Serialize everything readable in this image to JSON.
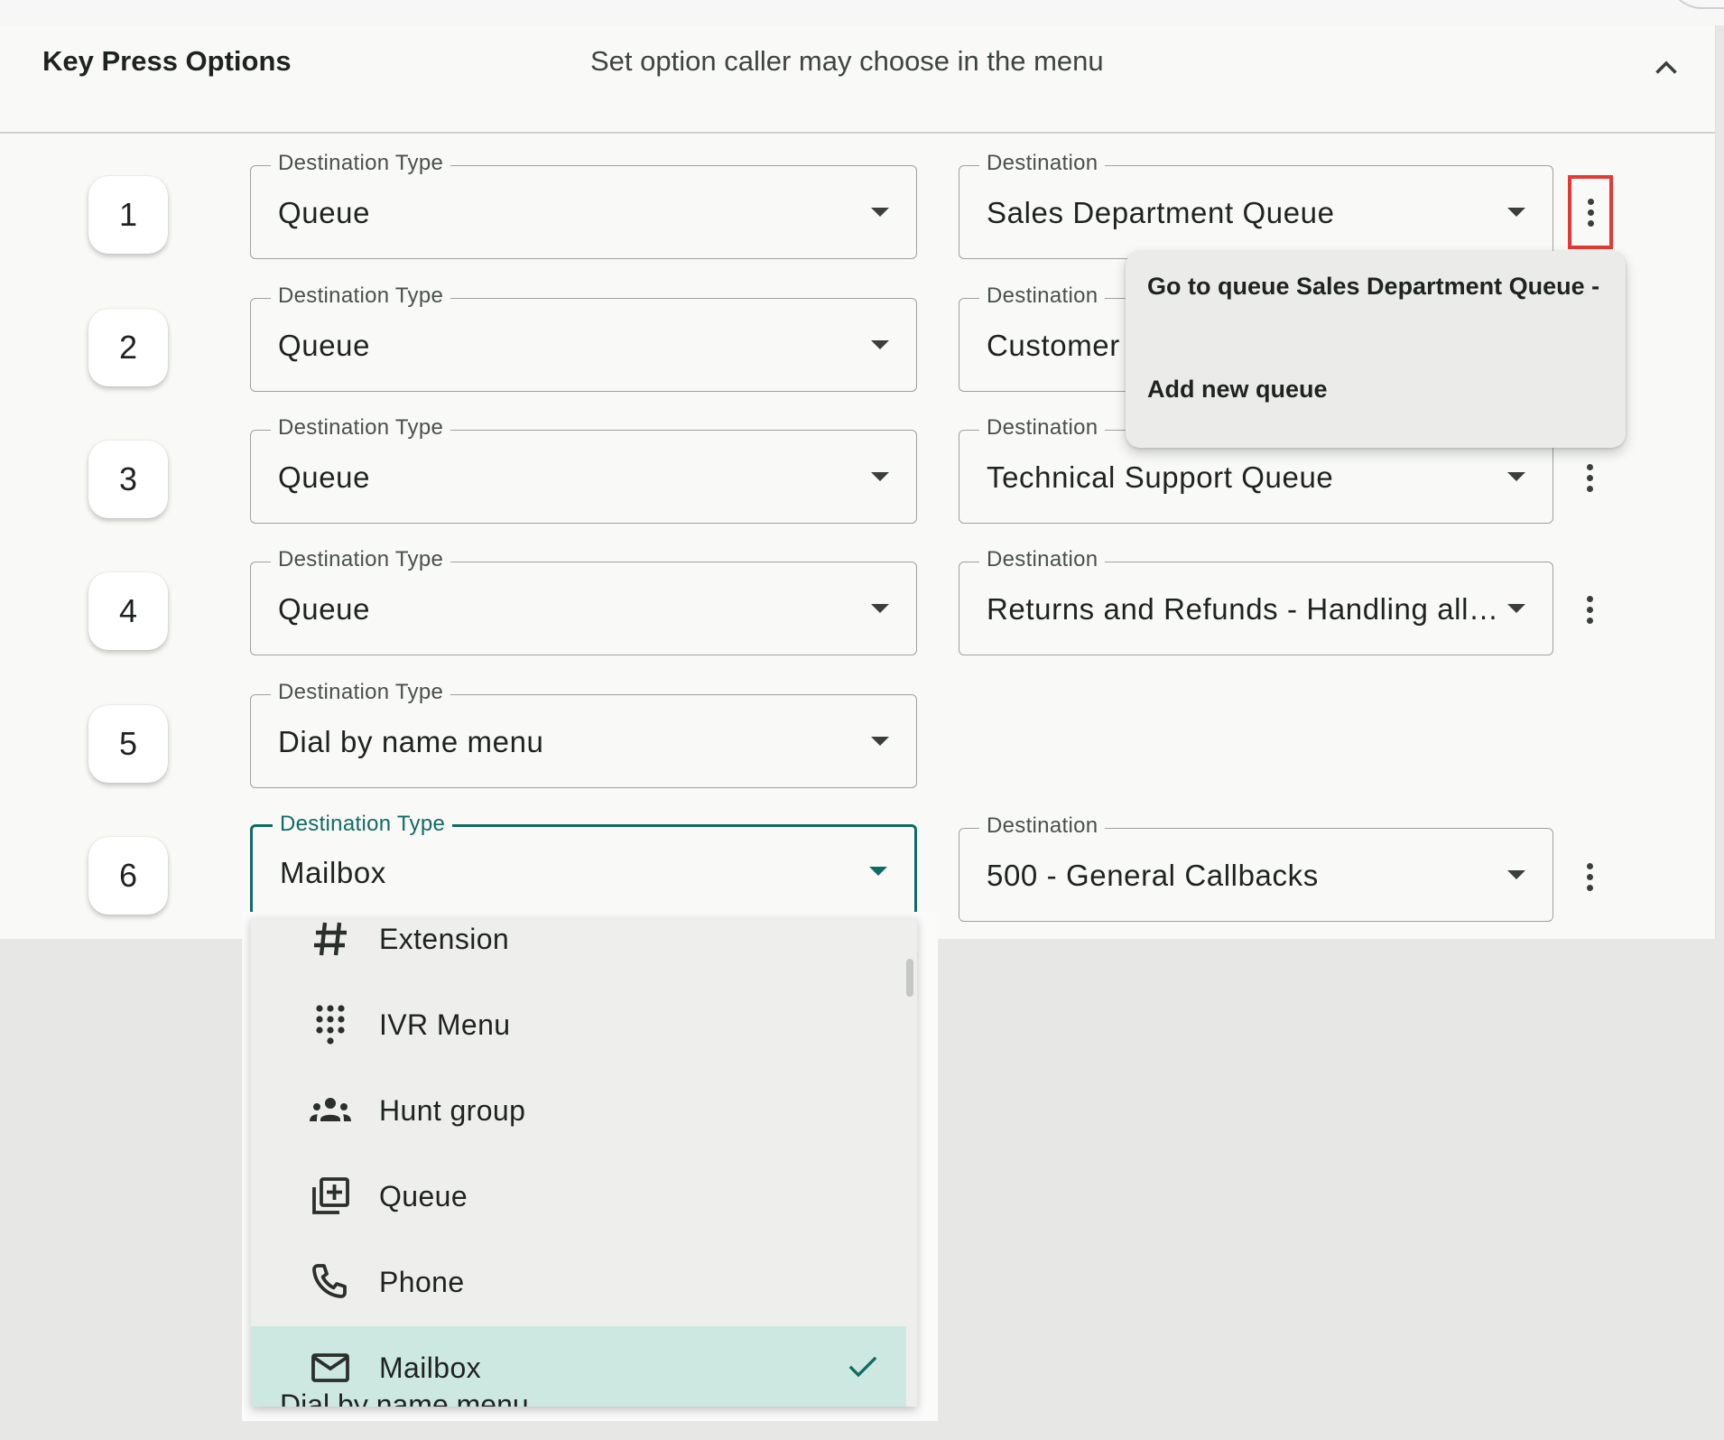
{
  "section": {
    "title": "Key Press Options",
    "description": "Set option caller may choose in the menu"
  },
  "labels": {
    "destination_type": "Destination Type",
    "destination": "Destination"
  },
  "rows": [
    {
      "key": "1",
      "type": "Queue",
      "destination": "Sales Department Queue"
    },
    {
      "key": "2",
      "type": "Queue",
      "destination": "Customer"
    },
    {
      "key": "3",
      "type": "Queue",
      "destination": "Technical Support Queue"
    },
    {
      "key": "4",
      "type": "Queue",
      "destination": "Returns and Refunds - Handling all p…"
    },
    {
      "key": "5",
      "type": "Dial by name menu"
    },
    {
      "key": "6",
      "type": "Mailbox",
      "destination": "500 - General Callbacks"
    }
  ],
  "context_menu": {
    "items": [
      "Go to queue Sales Department Queue -",
      "Add new queue"
    ]
  },
  "type_dropdown": {
    "options": [
      {
        "label": "Extension",
        "icon": "hash-icon"
      },
      {
        "label": "IVR Menu",
        "icon": "dialpad-icon"
      },
      {
        "label": "Hunt group",
        "icon": "group-icon"
      },
      {
        "label": "Queue",
        "icon": "queue-add-icon"
      },
      {
        "label": "Phone",
        "icon": "phone-icon"
      },
      {
        "label": "Mailbox",
        "icon": "mail-icon",
        "selected": true
      }
    ],
    "partially_visible_next": "Dial by name menu"
  },
  "colors": {
    "accent": "#106b63",
    "selected_bg": "#cde7e1",
    "highlight_outline": "#e53935"
  }
}
